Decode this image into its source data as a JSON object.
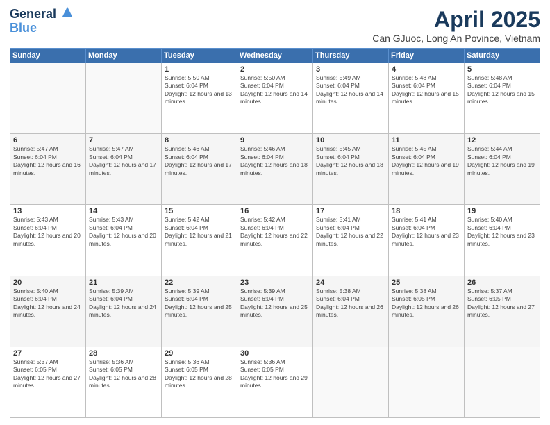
{
  "header": {
    "logo_line1": "General",
    "logo_line2": "Blue",
    "title": "April 2025",
    "subtitle": "Can GJuoc, Long An Povince, Vietnam"
  },
  "weekdays": [
    "Sunday",
    "Monday",
    "Tuesday",
    "Wednesday",
    "Thursday",
    "Friday",
    "Saturday"
  ],
  "weeks": [
    [
      {
        "day": "",
        "info": ""
      },
      {
        "day": "",
        "info": ""
      },
      {
        "day": "1",
        "info": "Sunrise: 5:50 AM\nSunset: 6:04 PM\nDaylight: 12 hours and 13 minutes."
      },
      {
        "day": "2",
        "info": "Sunrise: 5:50 AM\nSunset: 6:04 PM\nDaylight: 12 hours and 14 minutes."
      },
      {
        "day": "3",
        "info": "Sunrise: 5:49 AM\nSunset: 6:04 PM\nDaylight: 12 hours and 14 minutes."
      },
      {
        "day": "4",
        "info": "Sunrise: 5:48 AM\nSunset: 6:04 PM\nDaylight: 12 hours and 15 minutes."
      },
      {
        "day": "5",
        "info": "Sunrise: 5:48 AM\nSunset: 6:04 PM\nDaylight: 12 hours and 15 minutes."
      }
    ],
    [
      {
        "day": "6",
        "info": "Sunrise: 5:47 AM\nSunset: 6:04 PM\nDaylight: 12 hours and 16 minutes."
      },
      {
        "day": "7",
        "info": "Sunrise: 5:47 AM\nSunset: 6:04 PM\nDaylight: 12 hours and 17 minutes."
      },
      {
        "day": "8",
        "info": "Sunrise: 5:46 AM\nSunset: 6:04 PM\nDaylight: 12 hours and 17 minutes."
      },
      {
        "day": "9",
        "info": "Sunrise: 5:46 AM\nSunset: 6:04 PM\nDaylight: 12 hours and 18 minutes."
      },
      {
        "day": "10",
        "info": "Sunrise: 5:45 AM\nSunset: 6:04 PM\nDaylight: 12 hours and 18 minutes."
      },
      {
        "day": "11",
        "info": "Sunrise: 5:45 AM\nSunset: 6:04 PM\nDaylight: 12 hours and 19 minutes."
      },
      {
        "day": "12",
        "info": "Sunrise: 5:44 AM\nSunset: 6:04 PM\nDaylight: 12 hours and 19 minutes."
      }
    ],
    [
      {
        "day": "13",
        "info": "Sunrise: 5:43 AM\nSunset: 6:04 PM\nDaylight: 12 hours and 20 minutes."
      },
      {
        "day": "14",
        "info": "Sunrise: 5:43 AM\nSunset: 6:04 PM\nDaylight: 12 hours and 20 minutes."
      },
      {
        "day": "15",
        "info": "Sunrise: 5:42 AM\nSunset: 6:04 PM\nDaylight: 12 hours and 21 minutes."
      },
      {
        "day": "16",
        "info": "Sunrise: 5:42 AM\nSunset: 6:04 PM\nDaylight: 12 hours and 22 minutes."
      },
      {
        "day": "17",
        "info": "Sunrise: 5:41 AM\nSunset: 6:04 PM\nDaylight: 12 hours and 22 minutes."
      },
      {
        "day": "18",
        "info": "Sunrise: 5:41 AM\nSunset: 6:04 PM\nDaylight: 12 hours and 23 minutes."
      },
      {
        "day": "19",
        "info": "Sunrise: 5:40 AM\nSunset: 6:04 PM\nDaylight: 12 hours and 23 minutes."
      }
    ],
    [
      {
        "day": "20",
        "info": "Sunrise: 5:40 AM\nSunset: 6:04 PM\nDaylight: 12 hours and 24 minutes."
      },
      {
        "day": "21",
        "info": "Sunrise: 5:39 AM\nSunset: 6:04 PM\nDaylight: 12 hours and 24 minutes."
      },
      {
        "day": "22",
        "info": "Sunrise: 5:39 AM\nSunset: 6:04 PM\nDaylight: 12 hours and 25 minutes."
      },
      {
        "day": "23",
        "info": "Sunrise: 5:39 AM\nSunset: 6:04 PM\nDaylight: 12 hours and 25 minutes."
      },
      {
        "day": "24",
        "info": "Sunrise: 5:38 AM\nSunset: 6:04 PM\nDaylight: 12 hours and 26 minutes."
      },
      {
        "day": "25",
        "info": "Sunrise: 5:38 AM\nSunset: 6:05 PM\nDaylight: 12 hours and 26 minutes."
      },
      {
        "day": "26",
        "info": "Sunrise: 5:37 AM\nSunset: 6:05 PM\nDaylight: 12 hours and 27 minutes."
      }
    ],
    [
      {
        "day": "27",
        "info": "Sunrise: 5:37 AM\nSunset: 6:05 PM\nDaylight: 12 hours and 27 minutes."
      },
      {
        "day": "28",
        "info": "Sunrise: 5:36 AM\nSunset: 6:05 PM\nDaylight: 12 hours and 28 minutes."
      },
      {
        "day": "29",
        "info": "Sunrise: 5:36 AM\nSunset: 6:05 PM\nDaylight: 12 hours and 28 minutes."
      },
      {
        "day": "30",
        "info": "Sunrise: 5:36 AM\nSunset: 6:05 PM\nDaylight: 12 hours and 29 minutes."
      },
      {
        "day": "",
        "info": ""
      },
      {
        "day": "",
        "info": ""
      },
      {
        "day": "",
        "info": ""
      }
    ]
  ]
}
